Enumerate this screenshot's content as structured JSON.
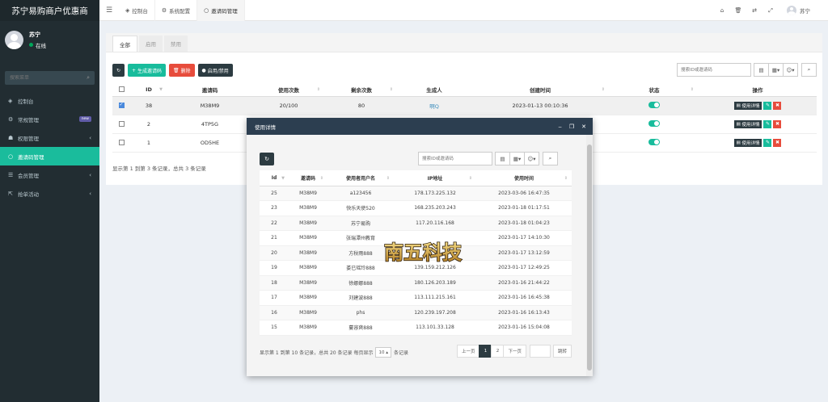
{
  "app": {
    "title": "苏宁易购商户优惠商"
  },
  "user": {
    "name": "苏宁",
    "status": "在线"
  },
  "sidebar": {
    "search_placeholder": "搜索菜单",
    "items": [
      {
        "label": "控制台"
      },
      {
        "label": "常规管理",
        "badge": "new"
      },
      {
        "label": "权限管理"
      },
      {
        "label": "邀请码管理"
      },
      {
        "label": "会员管理"
      },
      {
        "label": "抢单活动"
      }
    ]
  },
  "topnav": {
    "tabs": [
      {
        "label": "控制台"
      },
      {
        "label": "系统配置"
      },
      {
        "label": "邀请码管理"
      }
    ],
    "username": "苏宁"
  },
  "main": {
    "tabs": [
      {
        "label": "全部"
      },
      {
        "label": "启用"
      },
      {
        "label": "禁用"
      }
    ],
    "toolbar": {
      "generate": "生成邀请码",
      "delete": "删除",
      "toggle": "启用/禁用"
    },
    "search_placeholder": "搜索ID或邀请码",
    "columns": {
      "id": "ID",
      "code": "邀请码",
      "used": "使用次数",
      "remaining": "剩余次数",
      "creator": "生成人",
      "created": "创建时间",
      "status": "状态",
      "ops": "操作"
    },
    "rows": [
      {
        "id": "38",
        "code": "M38M9",
        "used": "20/100",
        "remaining": "80",
        "creator": "啊Q",
        "created": "2023-01-13 00:10:36"
      },
      {
        "id": "2",
        "code": "4TP5G",
        "used": "",
        "remaining": "",
        "creator": "",
        "created": ""
      },
      {
        "id": "1",
        "code": "OD5HE",
        "used": "",
        "remaining": "",
        "creator": "",
        "created": ""
      }
    ],
    "detail_label": "使用详情",
    "summary": "显示第 1 到第 3 条记录，总共 3 条记录"
  },
  "modal": {
    "title": "使用详情",
    "search_placeholder": "搜索ID或邀请码",
    "columns": {
      "id": "Id",
      "code": "邀请码",
      "username": "使用者用户名",
      "ip": "IP地址",
      "time": "使用时间"
    },
    "rows": [
      {
        "id": "25",
        "code": "M38M9",
        "username": "a123456",
        "ip": "178.173.225.132",
        "time": "2023-03-06 16:47:35"
      },
      {
        "id": "23",
        "code": "M38M9",
        "username": "快乐天使520",
        "ip": "168.235.203.243",
        "time": "2023-01-18 01:17:51"
      },
      {
        "id": "22",
        "code": "M38M9",
        "username": "苏宁易购",
        "ip": "117.20.116.168",
        "time": "2023-01-18 01:04:23"
      },
      {
        "id": "21",
        "code": "M38M9",
        "username": "张瑞潭州教育",
        "ip": "",
        "time": "2023-01-17 14:10:30"
      },
      {
        "id": "20",
        "code": "M38M9",
        "username": "方秋雨888",
        "ip": "",
        "time": "2023-01-17 13:12:59"
      },
      {
        "id": "19",
        "code": "M38M9",
        "username": "娄已瑶玲888",
        "ip": "139.159.212.126",
        "time": "2023-01-17 12:49:25"
      },
      {
        "id": "18",
        "code": "M38M9",
        "username": "徐娜娜888",
        "ip": "180.126.203.189",
        "time": "2023-01-16 21:44:22"
      },
      {
        "id": "17",
        "code": "M38M9",
        "username": "刘建波888",
        "ip": "113.111.215.161",
        "time": "2023-01-16 16:45:38"
      },
      {
        "id": "16",
        "code": "M38M9",
        "username": "phs",
        "ip": "120.239.197.208",
        "time": "2023-01-16 16:13:43"
      },
      {
        "id": "15",
        "code": "M38M9",
        "username": "蔓容爽888",
        "ip": "113.101.33.128",
        "time": "2023-01-16 15:04:08"
      }
    ],
    "footer": {
      "summary": "显示第 1 到第 10 条记录，总共 20 条记录 每页显示",
      "per_page": "10",
      "per_page_suffix": "条记录"
    },
    "pager": {
      "prev": "上一页",
      "p1": "1",
      "p2": "2",
      "next": "下一页",
      "jump": "跳转"
    }
  },
  "watermark": {
    "text": "南五科技"
  },
  "colors": {
    "sidebar": "#222d32",
    "accent": "#1abc9c",
    "danger": "#e74c3c",
    "dark": "#2c3b41",
    "modal_header": "#2c3e50"
  }
}
